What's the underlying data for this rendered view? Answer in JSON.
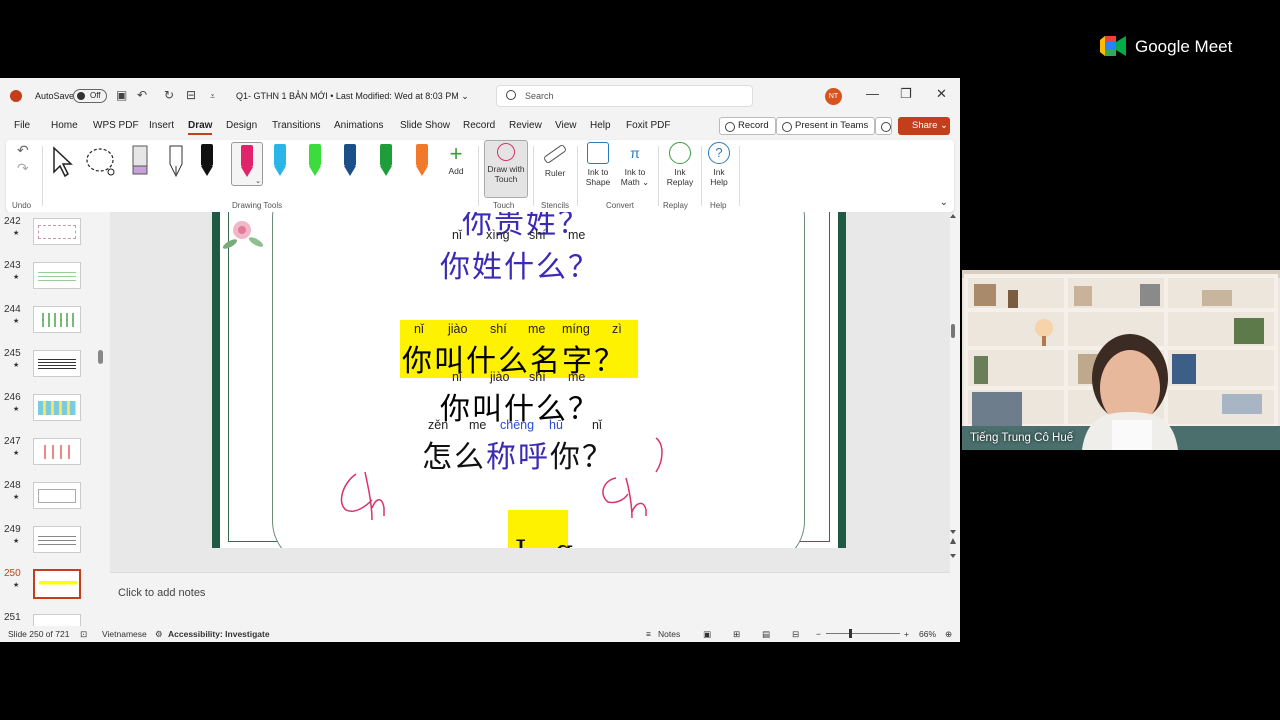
{
  "titlebar": {
    "autosave_label": "AutoSave",
    "autosave_state": "Off",
    "document_title": "Q1- GTHN 1 BẢN MỚI • Last Modified: Wed at 8:03 PM ⌄",
    "search_placeholder": "Search",
    "user_initials": "NT",
    "minimize": "—",
    "restore": "❐",
    "close": "✕"
  },
  "tabs": {
    "items": [
      "File",
      "Home",
      "WPS PDF",
      "Insert",
      "Draw",
      "Design",
      "Transitions",
      "Animations",
      "Slide Show",
      "Record",
      "Review",
      "View",
      "Help",
      "Foxit PDF"
    ],
    "active": "Draw",
    "record_label": "Record",
    "present_teams_label": "Present in Teams",
    "share_label": "Share ⌄"
  },
  "ribbon": {
    "undo_group": "Undo",
    "drawing_tools_group": "Drawing Tools",
    "add_label": "Add",
    "draw_with_touch": "Draw with Touch",
    "touch_group": "Touch",
    "ruler": "Ruler",
    "stencils_group": "Stencils",
    "ink_to_shape": "Ink to Shape",
    "ink_to_math": "Ink to Math ⌄",
    "convert_group": "Convert",
    "ink_replay": "Ink Replay",
    "replay_group": "Replay",
    "ink_help": "Ink Help",
    "help_group": "Help",
    "pen_colors": [
      "#111111",
      "#e0236b",
      "#29b5e8",
      "#3ddc3d",
      "#1c4f8a",
      "#1e9e3b",
      "#f07a2a"
    ]
  },
  "slides": {
    "numbers": [
      "242",
      "243",
      "244",
      "245",
      "246",
      "247",
      "248",
      "249",
      "250",
      "251"
    ],
    "active": "250",
    "star": "★"
  },
  "slide": {
    "line0_han": "你贵姓？",
    "line1_pinyin": [
      "nǐ",
      "xìng",
      "shí",
      "me"
    ],
    "line1_han": "你姓什么？",
    "line2_pinyin": [
      "nǐ",
      "jiào",
      "shí",
      "me",
      "míng",
      "zì"
    ],
    "line2_han": "你叫什么名字",
    "line2_q": "？",
    "line3_pinyin": [
      "nǐ",
      "jiào",
      "shí",
      "me"
    ],
    "line3_han": "你叫什么？",
    "line4_pinyin": [
      "zěn",
      "me",
      "chēng",
      "hū",
      "nǐ"
    ],
    "line4_han_a": "怎么",
    "line4_han_b": "称呼",
    "line4_han_c": "你？",
    "jq_text": "J q",
    "ink_color": "#d8336b"
  },
  "notes_placeholder": "Click to add notes",
  "statusbar": {
    "slide_count": "Slide 250 of 721",
    "language": "Vietnamese",
    "accessibility": "Accessibility: Investigate",
    "notes": "Notes",
    "zoom": "66%"
  },
  "meet": {
    "brand": "Google Meet",
    "participant": "Tiếng Trung Cô Huế"
  }
}
